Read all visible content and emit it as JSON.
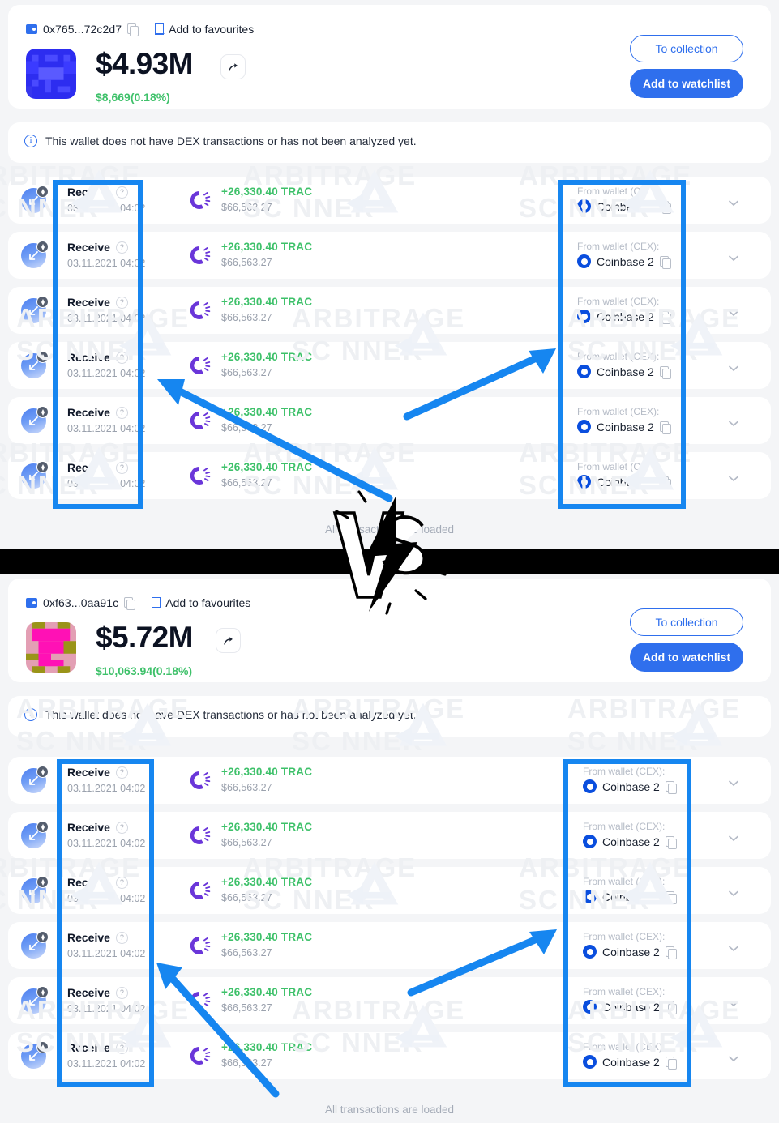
{
  "page": {
    "background": "#f4f5f7",
    "accent_blue": "#2f6fed",
    "highlight_blue": "#1686f0",
    "green": "#3ec16a",
    "watermark_text_line1": "ARBITRAGE",
    "watermark_text_line2": "SC        NNER",
    "center_logo": "vs-logo"
  },
  "panels": [
    {
      "id": "wallet-top",
      "header": {
        "wallet_icon": "wallet-icon",
        "address": "0x765...72c2d7",
        "copy_icon": "copy-icon",
        "bookmark_icon": "bookmark-icon",
        "favourites_label": "Add to favourites",
        "avatar": "pixel-avatar-blue",
        "avatar_colors": [
          "#2f2fe8",
          "#3b3bf5",
          "#5757ff",
          "#1f1fcc"
        ],
        "total_value": "$4.93M",
        "share_icon": "share-icon",
        "change_value": "$8,669(0.18%)",
        "to_collection_label": "To collection",
        "add_watchlist_label": "Add to watchlist"
      },
      "info_banner": {
        "icon": "info-icon",
        "text": "This wallet does not have DEX transactions or has not been analyzed yet."
      },
      "transactions": [
        {
          "direction_icon": "receive-arrow-icon",
          "chain_icon": "ethereum-icon",
          "type": "Receive",
          "help_icon": "question-icon",
          "date": "03.11.2021 04:02",
          "token_icon": "trac-token-icon",
          "amount": "+26,330.40 TRAC",
          "usd": "$66,563.27",
          "wallet_label": "From wallet (CEX):",
          "wallet_icon": "coinbase-icon",
          "wallet_name": "Coinbase 2",
          "copy_icon": "copy-icon",
          "expand_icon": "chevron-down-icon"
        },
        {
          "direction_icon": "receive-arrow-icon",
          "chain_icon": "ethereum-icon",
          "type": "Receive",
          "help_icon": "question-icon",
          "date": "03.11.2021 04:02",
          "token_icon": "trac-token-icon",
          "amount": "+26,330.40 TRAC",
          "usd": "$66,563.27",
          "wallet_label": "From wallet (CEX):",
          "wallet_icon": "coinbase-icon",
          "wallet_name": "Coinbase 2",
          "copy_icon": "copy-icon",
          "expand_icon": "chevron-down-icon"
        },
        {
          "direction_icon": "receive-arrow-icon",
          "chain_icon": "ethereum-icon",
          "type": "Receive",
          "help_icon": "question-icon",
          "date": "03.11.2021 04:02",
          "token_icon": "trac-token-icon",
          "amount": "+26,330.40 TRAC",
          "usd": "$66,563.27",
          "wallet_label": "From wallet (CEX):",
          "wallet_icon": "coinbase-icon",
          "wallet_name": "Coinbase 2",
          "copy_icon": "copy-icon",
          "expand_icon": "chevron-down-icon"
        },
        {
          "direction_icon": "receive-arrow-icon",
          "chain_icon": "ethereum-icon",
          "type": "Receive",
          "help_icon": "question-icon",
          "date": "03.11.2021 04:02",
          "token_icon": "trac-token-icon",
          "amount": "+26,330.40 TRAC",
          "usd": "$66,563.27",
          "wallet_label": "From wallet (CEX):",
          "wallet_icon": "coinbase-icon",
          "wallet_name": "Coinbase 2",
          "copy_icon": "copy-icon",
          "expand_icon": "chevron-down-icon"
        },
        {
          "direction_icon": "receive-arrow-icon",
          "chain_icon": "ethereum-icon",
          "type": "Receive",
          "help_icon": "question-icon",
          "date": "03.11.2021 04:02",
          "token_icon": "trac-token-icon",
          "amount": "+26,330.40 TRAC",
          "usd": "$66,563.27",
          "wallet_label": "From wallet (CEX):",
          "wallet_icon": "coinbase-icon",
          "wallet_name": "Coinbase 2",
          "copy_icon": "copy-icon",
          "expand_icon": "chevron-down-icon"
        },
        {
          "direction_icon": "receive-arrow-icon",
          "chain_icon": "ethereum-icon",
          "type": "Receive",
          "help_icon": "question-icon",
          "date": "03.11.2021 04:02",
          "token_icon": "trac-token-icon",
          "amount": "+26,330.40 TRAC",
          "usd": "$66,563.27",
          "wallet_label": "From wallet (CEX):",
          "wallet_icon": "coinbase-icon",
          "wallet_name": "Coinbase 2",
          "copy_icon": "copy-icon",
          "expand_icon": "chevron-down-icon"
        }
      ],
      "footer_text": "All transactions are loaded"
    },
    {
      "id": "wallet-bottom",
      "header": {
        "wallet_icon": "wallet-icon",
        "address": "0xf63...0aa91c",
        "copy_icon": "copy-icon",
        "bookmark_icon": "bookmark-icon",
        "favourites_label": "Add to favourites",
        "avatar": "pixel-avatar-pink",
        "avatar_colors": [
          "#ff11b5",
          "#e8a0b4",
          "#9a9418",
          "#f03fc0"
        ],
        "total_value": "$5.72M",
        "share_icon": "share-icon",
        "change_value": "$10,063.94(0.18%)",
        "to_collection_label": "To collection",
        "add_watchlist_label": "Add to watchlist"
      },
      "info_banner": {
        "icon": "info-icon",
        "text": "This wallet does not have DEX transactions or has not been analyzed yet."
      },
      "transactions": [
        {
          "direction_icon": "receive-arrow-icon",
          "chain_icon": "ethereum-icon",
          "type": "Receive",
          "help_icon": "question-icon",
          "date": "03.11.2021 04:02",
          "token_icon": "trac-token-icon",
          "amount": "+26,330.40 TRAC",
          "usd": "$66,563.27",
          "wallet_label": "From wallet (CEX):",
          "wallet_icon": "coinbase-icon",
          "wallet_name": "Coinbase 2",
          "copy_icon": "copy-icon",
          "expand_icon": "chevron-down-icon"
        },
        {
          "direction_icon": "receive-arrow-icon",
          "chain_icon": "ethereum-icon",
          "type": "Receive",
          "help_icon": "question-icon",
          "date": "03.11.2021 04:02",
          "token_icon": "trac-token-icon",
          "amount": "+26,330.40 TRAC",
          "usd": "$66,563.27",
          "wallet_label": "From wallet (CEX):",
          "wallet_icon": "coinbase-icon",
          "wallet_name": "Coinbase 2",
          "copy_icon": "copy-icon",
          "expand_icon": "chevron-down-icon"
        },
        {
          "direction_icon": "receive-arrow-icon",
          "chain_icon": "ethereum-icon",
          "type": "Receive",
          "help_icon": "question-icon",
          "date": "03.11.2021 04:02",
          "token_icon": "trac-token-icon",
          "amount": "+26,330.40 TRAC",
          "usd": "$66,563.27",
          "wallet_label": "From wallet (CEX):",
          "wallet_icon": "coinbase-icon",
          "wallet_name": "Coinbase 2",
          "copy_icon": "copy-icon",
          "expand_icon": "chevron-down-icon"
        },
        {
          "direction_icon": "receive-arrow-icon",
          "chain_icon": "ethereum-icon",
          "type": "Receive",
          "help_icon": "question-icon",
          "date": "03.11.2021 04:02",
          "token_icon": "trac-token-icon",
          "amount": "+26,330.40 TRAC",
          "usd": "$66,563.27",
          "wallet_label": "From wallet (CEX):",
          "wallet_icon": "coinbase-icon",
          "wallet_name": "Coinbase 2",
          "copy_icon": "copy-icon",
          "expand_icon": "chevron-down-icon"
        },
        {
          "direction_icon": "receive-arrow-icon",
          "chain_icon": "ethereum-icon",
          "type": "Receive",
          "help_icon": "question-icon",
          "date": "03.11.2021 04:02",
          "token_icon": "trac-token-icon",
          "amount": "+26,330.40 TRAC",
          "usd": "$66,563.27",
          "wallet_label": "From wallet (CEX):",
          "wallet_icon": "coinbase-icon",
          "wallet_name": "Coinbase 2",
          "copy_icon": "copy-icon",
          "expand_icon": "chevron-down-icon"
        },
        {
          "direction_icon": "receive-arrow-icon",
          "chain_icon": "ethereum-icon",
          "type": "Receive",
          "help_icon": "question-icon",
          "date": "03.11.2021 04:02",
          "token_icon": "trac-token-icon",
          "amount": "+26,330.40 TRAC",
          "usd": "$66,563.27",
          "wallet_label": "From wallet (CEX):",
          "wallet_icon": "coinbase-icon",
          "wallet_name": "Coinbase 2",
          "copy_icon": "copy-icon",
          "expand_icon": "chevron-down-icon"
        }
      ],
      "footer_text": "All transactions are loaded"
    }
  ]
}
